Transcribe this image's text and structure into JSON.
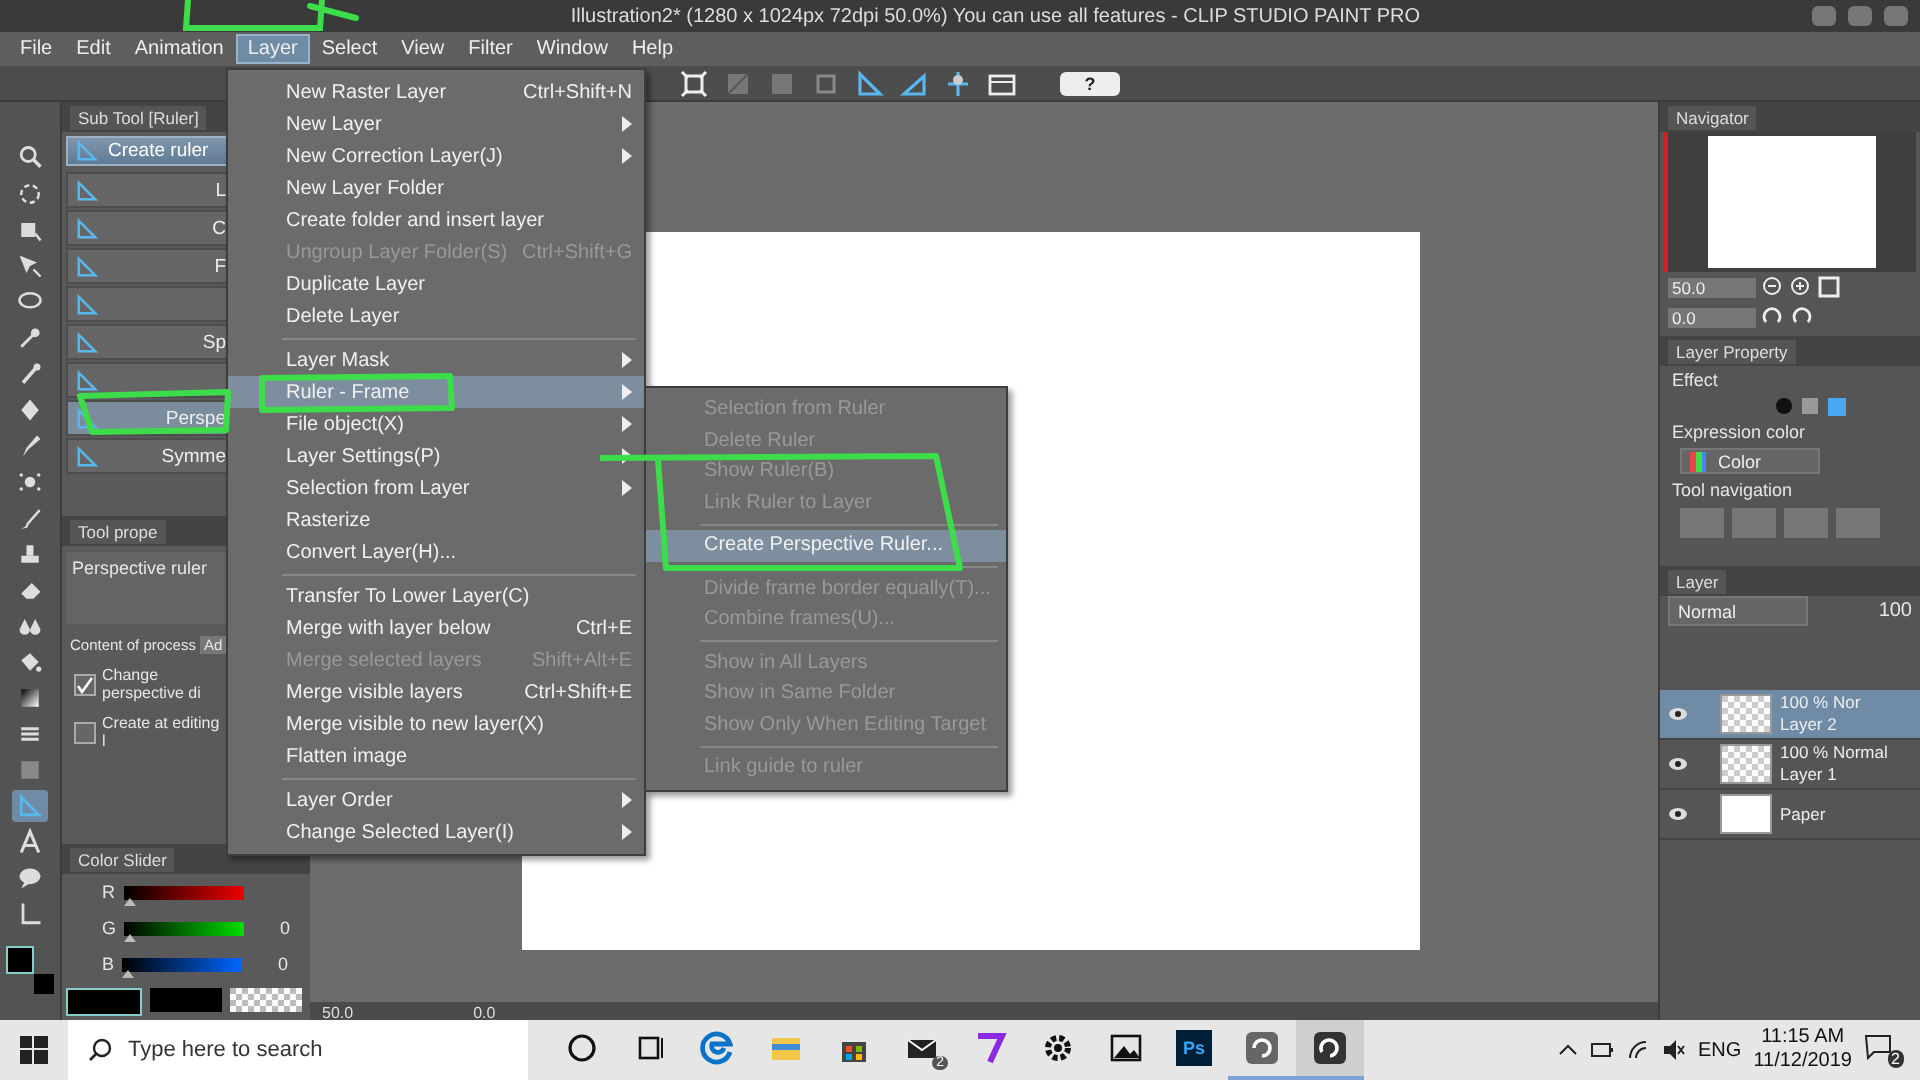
{
  "window": {
    "title": "Illustration2* (1280 x 1024px 72dpi 50.0%)  You can use all features - CLIP STUDIO PAINT PRO"
  },
  "menu_bar": [
    {
      "label": "File",
      "selected": false
    },
    {
      "label": "Edit",
      "selected": false
    },
    {
      "label": "Animation",
      "selected": false
    },
    {
      "label": "Layer",
      "selected": true
    },
    {
      "label": "Select",
      "selected": false
    },
    {
      "label": "View",
      "selected": false
    },
    {
      "label": "Filter",
      "selected": false
    },
    {
      "label": "Window",
      "selected": false
    },
    {
      "label": "Help",
      "selected": false
    }
  ],
  "toolbar": {
    "help": "?"
  },
  "tools": [
    {
      "selected": false
    },
    {
      "selected": false
    },
    {
      "selected": false
    },
    {
      "selected": false
    },
    {
      "selected": false
    },
    {
      "selected": false
    },
    {
      "selected": false
    },
    {
      "selected": false
    },
    {
      "selected": false
    },
    {
      "selected": false
    },
    {
      "selected": false
    },
    {
      "selected": false
    },
    {
      "selected": false
    },
    {
      "selected": false
    },
    {
      "selected": false
    },
    {
      "selected": false
    },
    {
      "selected": false
    },
    {
      "selected": false
    },
    {
      "selected": true
    },
    {
      "selected": false
    },
    {
      "selected": false
    },
    {
      "selected": false
    }
  ],
  "sub_tool": {
    "title": "Sub Tool [Ruler]",
    "create_button": "Create ruler",
    "items": [
      {
        "label": "L",
        "selected": false
      },
      {
        "label": "C",
        "selected": false
      },
      {
        "label": "F",
        "selected": false
      },
      {
        "selected": false
      },
      {
        "label": "Sp",
        "selected": false
      },
      {
        "selected": false
      },
      {
        "label": "Perspe",
        "selected": true
      },
      {
        "label": "Symme",
        "selected": false
      }
    ]
  },
  "tool_property": {
    "title": "Tool prope",
    "name": "Perspective ruler",
    "content_label": "Content of process",
    "content_value": "Ad",
    "options": [
      {
        "label": "Change perspective di",
        "checked": true
      },
      {
        "label": "Create at editing l",
        "checked": false
      }
    ]
  },
  "color_slider": {
    "title": "Color Slider",
    "channels": [
      {
        "name": "R",
        "level": 0
      },
      {
        "name": "G",
        "value": "0",
        "level": 0
      },
      {
        "name": "B",
        "value": "0",
        "level": 0
      }
    ]
  },
  "layer_menu": {
    "items": [
      {
        "kind": "item",
        "label": "New Raster Layer",
        "shortcut": "Ctrl+Shift+N",
        "disabled": false,
        "submenu": false,
        "selected": false
      },
      {
        "kind": "item",
        "label": "New Layer",
        "disabled": false,
        "submenu": true,
        "selected": false
      },
      {
        "kind": "item",
        "label": "New Correction Layer(J)",
        "disabled": false,
        "submenu": true,
        "selected": false
      },
      {
        "kind": "item",
        "label": "New Layer Folder",
        "disabled": false,
        "submenu": false,
        "selected": false
      },
      {
        "kind": "item",
        "label": "Create folder and insert layer",
        "disabled": false,
        "submenu": false,
        "selected": false
      },
      {
        "kind": "item",
        "label": "Ungroup Layer Folder(S)",
        "shortcut": "Ctrl+Shift+G",
        "disabled": true,
        "submenu": false,
        "selected": false
      },
      {
        "kind": "item",
        "label": "Duplicate Layer",
        "disabled": false,
        "submenu": false,
        "selected": false
      },
      {
        "kind": "item",
        "label": "Delete Layer",
        "disabled": false,
        "submenu": false,
        "selected": false
      },
      {
        "kind": "separator"
      },
      {
        "kind": "item",
        "label": "Layer Mask",
        "disabled": false,
        "submenu": true,
        "selected": false
      },
      {
        "kind": "item",
        "label": "Ruler - Frame",
        "disabled": false,
        "submenu": true,
        "selected": true
      },
      {
        "kind": "item",
        "label": "File object(X)",
        "disabled": false,
        "submenu": true,
        "selected": false
      },
      {
        "kind": "item",
        "label": "Layer Settings(P)",
        "disabled": false,
        "submenu": true,
        "selected": false
      },
      {
        "kind": "item",
        "label": "Selection from Layer",
        "disabled": false,
        "submenu": true,
        "selected": false
      },
      {
        "kind": "item",
        "label": "Rasterize",
        "disabled": false,
        "submenu": false,
        "selected": false
      },
      {
        "kind": "item",
        "label": "Convert Layer(H)...",
        "disabled": false,
        "submenu": false,
        "selected": false
      },
      {
        "kind": "separator"
      },
      {
        "kind": "item",
        "label": "Transfer To Lower Layer(C)",
        "disabled": false,
        "submenu": false,
        "selected": false
      },
      {
        "kind": "item",
        "label": "Merge with layer below",
        "shortcut": "Ctrl+E",
        "disabled": false,
        "submenu": false,
        "selected": false
      },
      {
        "kind": "item",
        "label": "Merge selected layers",
        "shortcut": "Shift+Alt+E",
        "disabled": true,
        "submenu": false,
        "selected": false
      },
      {
        "kind": "item",
        "label": "Merge visible layers",
        "shortcut": "Ctrl+Shift+E",
        "disabled": false,
        "submenu": false,
        "selected": false
      },
      {
        "kind": "item",
        "label": "Merge visible to new layer(X)",
        "disabled": false,
        "submenu": false,
        "selected": false
      },
      {
        "kind": "item",
        "label": "Flatten image",
        "disabled": false,
        "submenu": false,
        "selected": false
      },
      {
        "kind": "separator"
      },
      {
        "kind": "item",
        "label": "Layer Order",
        "disabled": false,
        "submenu": true,
        "selected": false
      },
      {
        "kind": "item",
        "label": "Change Selected Layer(I)",
        "disabled": false,
        "submenu": true,
        "selected": false
      }
    ]
  },
  "ruler_frame_submenu": {
    "items": [
      {
        "kind": "item",
        "label": "Selection from Ruler",
        "disabled": true,
        "selected": false
      },
      {
        "kind": "item",
        "label": "Delete Ruler",
        "disabled": true,
        "selected": false
      },
      {
        "kind": "item",
        "label": "Show Ruler(B)",
        "disabled": true,
        "selected": false
      },
      {
        "kind": "item",
        "label": "Link Ruler to Layer",
        "disabled": true,
        "selected": false
      },
      {
        "kind": "separator"
      },
      {
        "kind": "item",
        "label": "Create Perspective Ruler...",
        "disabled": false,
        "selected": true
      },
      {
        "kind": "separator"
      },
      {
        "kind": "item",
        "label": "Divide frame border equally(T)...",
        "disabled": true,
        "selected": false
      },
      {
        "kind": "item",
        "label": "Combine frames(U)...",
        "disabled": true,
        "selected": false
      },
      {
        "kind": "separator"
      },
      {
        "kind": "item",
        "label": "Show in All Layers",
        "disabled": true,
        "selected": false
      },
      {
        "kind": "item",
        "label": "Show in Same Folder",
        "disabled": true,
        "selected": false
      },
      {
        "kind": "item",
        "label": "Show Only When Editing Target",
        "disabled": true,
        "selected": false
      },
      {
        "kind": "separator"
      },
      {
        "kind": "item",
        "label": "Link guide to ruler",
        "disabled": true,
        "selected": false
      }
    ]
  },
  "canvas_status": {
    "zoom": "50.0",
    "angle": "0.0"
  },
  "navigator": {
    "title": "Navigator",
    "zoom": "50.0",
    "angle": "0.0"
  },
  "layer_property": {
    "title": "Layer Property",
    "effect_label": "Effect",
    "expression_label": "Expression color",
    "expression_value": "Color",
    "tool_nav_label": "Tool navigation"
  },
  "layer_panel": {
    "title": "Layer",
    "blend_mode": "Normal",
    "opacity": "100",
    "layers": [
      {
        "kind": "raster",
        "info": "100 % Nor",
        "name": "Layer 2",
        "selected": true,
        "visible": true
      },
      {
        "kind": "raster",
        "info": "100 % Normal",
        "name": "Layer 1",
        "selected": false,
        "visible": true
      },
      {
        "kind": "paper",
        "name": "Paper",
        "selected": false,
        "visible": true
      }
    ]
  },
  "taskbar": {
    "search_placeholder": "Type here to search",
    "apps": [
      {
        "kind": "cortana",
        "open": false,
        "selected": false
      },
      {
        "kind": "task-view",
        "open": false,
        "selected": false
      },
      {
        "kind": "browser",
        "open": false,
        "selected": false
      },
      {
        "kind": "folder",
        "open": false,
        "selected": false
      },
      {
        "kind": "store",
        "open": false,
        "selected": false
      },
      {
        "kind": "mail",
        "badge": "2",
        "open": false,
        "selected": false
      },
      {
        "kind": "pen-app",
        "open": false,
        "selected": false
      },
      {
        "kind": "settings",
        "open": false,
        "selected": false
      },
      {
        "kind": "photos",
        "open": false,
        "selected": false
      },
      {
        "kind": "ps",
        "label": "Ps",
        "open": false,
        "selected": false
      },
      {
        "kind": "swirl",
        "open": true,
        "selected": false
      },
      {
        "kind": "swirl-alt",
        "open": true,
        "selected": true
      }
    ],
    "language": "ENG",
    "time": "11:15 AM",
    "date": "11/12/2019",
    "notifications": "2"
  }
}
